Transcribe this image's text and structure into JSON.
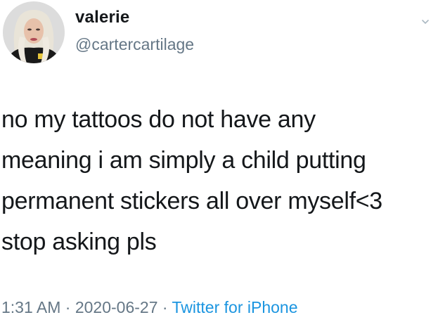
{
  "tweet": {
    "author": {
      "display_name": "valerie",
      "handle": "@cartercartilage",
      "avatar_icon": "profile-photo"
    },
    "text": "no my tattoos do not have any\nmeaning i am simply a child putting\npermanent stickers all over myself<3\nstop asking pls",
    "meta": {
      "time": "1:31 AM",
      "separator": " · ",
      "date": "2020-06-27",
      "source": "Twitter for iPhone"
    }
  },
  "colors": {
    "text_primary": "#14171a",
    "text_secondary": "#657786",
    "link": "#1b95e0",
    "background": "#ffffff"
  }
}
